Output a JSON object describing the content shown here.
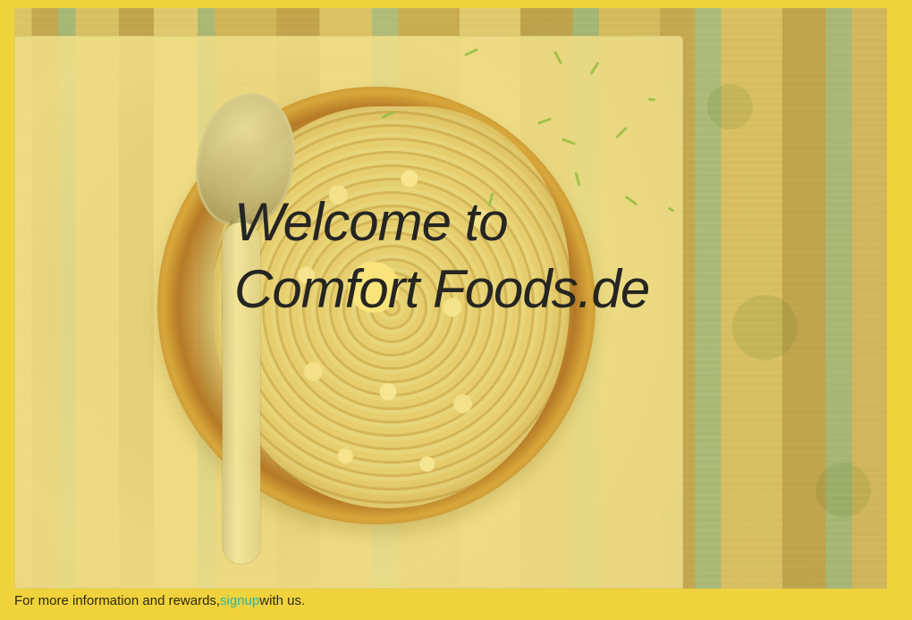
{
  "hero": {
    "title_line_1": "Welcome to",
    "title_line_2": "Comfort Foods.de"
  },
  "footer": {
    "prefix": "For more information and rewards, ",
    "link_label": "signup",
    "suffix": " with us."
  },
  "colors": {
    "frame": "#efd23c",
    "title_text": "#252522",
    "link": "#2eb6a4"
  }
}
